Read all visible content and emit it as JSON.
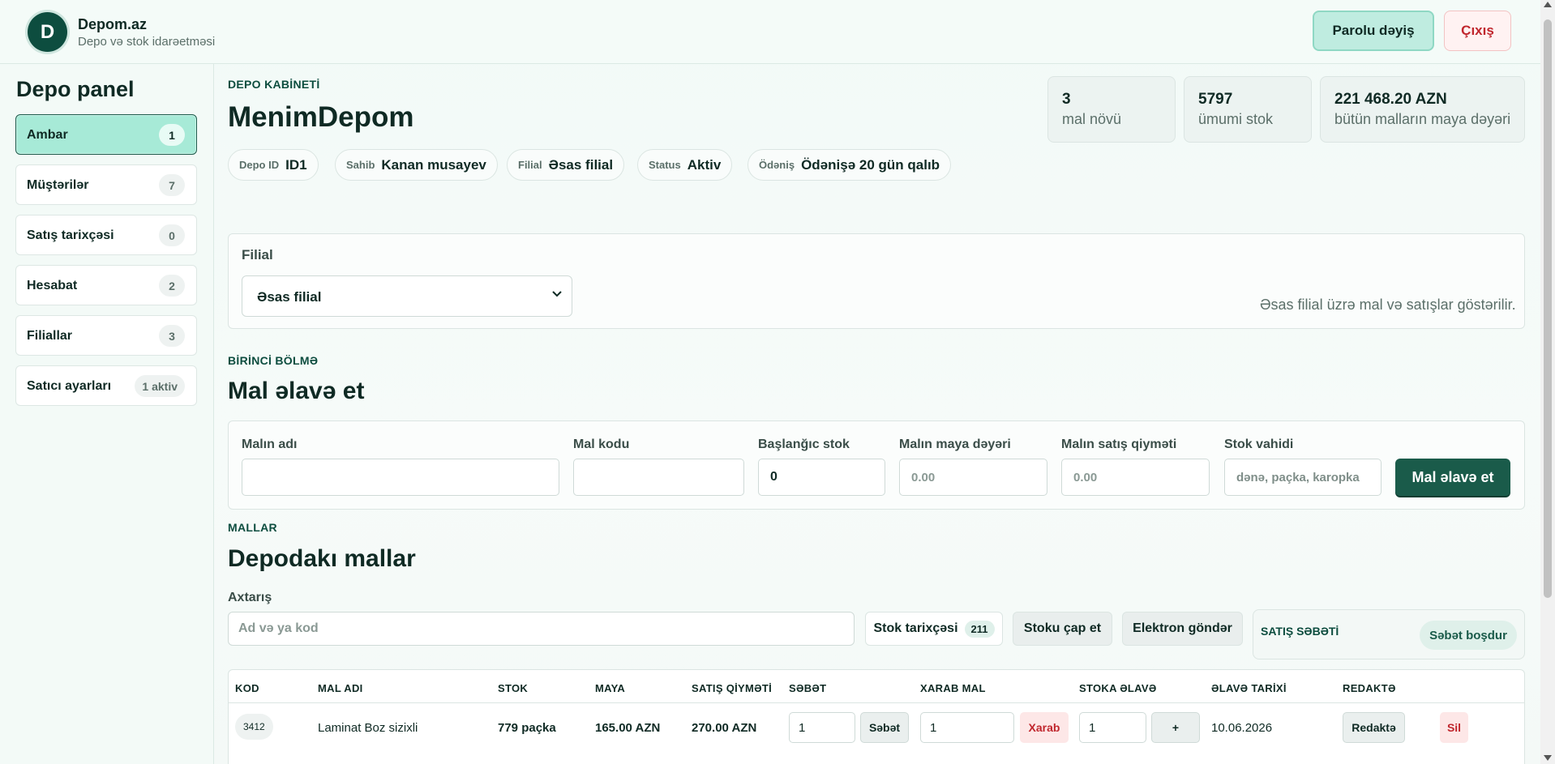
{
  "header": {
    "logo_letter": "D",
    "brand": "Depom.az",
    "subtitle": "Depo və stok idarəetməsi",
    "change_password": "Parolu dəyiş",
    "logout": "Çıxış"
  },
  "sidebar": {
    "title": "Depo panel",
    "items": [
      {
        "label": "Ambar",
        "badge": "1"
      },
      {
        "label": "Müştərilər",
        "badge": "7"
      },
      {
        "label": "Satış tarixçəsi",
        "badge": "0"
      },
      {
        "label": "Hesabat",
        "badge": "2"
      },
      {
        "label": "Filiallar",
        "badge": "3"
      },
      {
        "label": "Satıcı ayarları",
        "badge": "1 aktiv"
      }
    ]
  },
  "cabinet": {
    "eyebrow": "DEPO KABİNETİ",
    "title": "MenimDepom",
    "chips": [
      {
        "key": "Depo ID",
        "value": "ID1"
      },
      {
        "key": "Sahib",
        "value": "Kanan musayev"
      },
      {
        "key": "Filial",
        "value": "Əsas filial"
      },
      {
        "key": "Status",
        "value": "Aktiv"
      },
      {
        "key": "Ödəniş",
        "value": "Ödənişə 20 gün qalıb"
      }
    ],
    "stats": [
      {
        "value": "3",
        "label": "mal növü"
      },
      {
        "value": "5797",
        "label": "ümumi stok"
      },
      {
        "value": "221 468.20 AZN",
        "label": "bütün malların maya dəyəri"
      }
    ]
  },
  "branch": {
    "label": "Filial",
    "selected": "Əsas filial",
    "hint": "Əsas filial üzrə mal və satışlar göstərilir."
  },
  "add_product": {
    "eyebrow": "BİRİNCİ BÖLMƏ",
    "title": "Mal əlavə et",
    "fields": {
      "name_label": "Malın adı",
      "code_label": "Mal kodu",
      "stock_label": "Başlanğıc stok",
      "stock_value": "0",
      "cost_label": "Malın maya dəyəri",
      "cost_placeholder": "0.00",
      "price_label": "Malın satış qiyməti",
      "price_placeholder": "0.00",
      "unit_label": "Stok vahidi",
      "unit_placeholder": "dənə, paçka, karopka"
    },
    "submit": "Mal əlavə et"
  },
  "products": {
    "eyebrow": "MALLAR",
    "title": "Depodakı mallar",
    "search_label": "Axtarış",
    "search_placeholder": "Ad və ya kod",
    "stock_history": "Stok tarixçəsi",
    "stock_history_count": "211",
    "print_stock": "Stoku çap et",
    "send_email": "Elektron göndər",
    "cart_title": "SATIŞ SƏBƏTİ",
    "clear_cart": "Səbət boşdur",
    "columns": [
      "KOD",
      "MAL ADI",
      "STOK",
      "MAYA",
      "SATIŞ QİYMƏTİ",
      "SƏBƏT",
      "XARAB MAL",
      "STOKA ƏLAVƏ",
      "ƏLAVƏ TARİXİ",
      "REDAKTƏ"
    ],
    "rows": [
      {
        "code": "3412",
        "name": "Laminat Boz sizixli",
        "stock": "779 paçka",
        "cost": "165.00 AZN",
        "price": "270.00 AZN",
        "cart_qty": "1",
        "cart_btn": "Səbət",
        "damaged_qty": "1",
        "damaged_btn": "Xarab",
        "add_qty": "1",
        "add_btn": "+",
        "date": "10.06.2026",
        "edit_btn": "Redaktə",
        "delete_btn": "Sil"
      }
    ]
  }
}
